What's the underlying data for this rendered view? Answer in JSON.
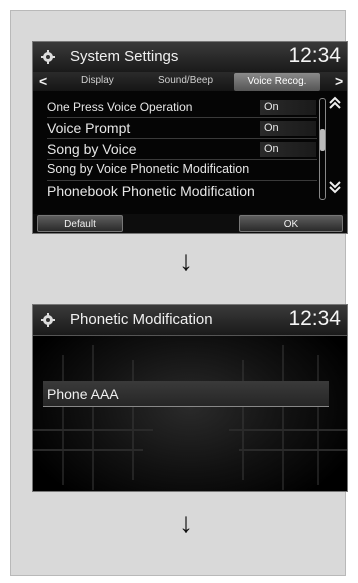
{
  "screen1": {
    "title": "System Settings",
    "clock": "12:34",
    "tabs": {
      "prev_arrow": "<",
      "tab1": "Display",
      "tab2": "Sound/Beep",
      "tab3_active": "Voice Recog.",
      "next_arrow": ">"
    },
    "rows": [
      {
        "label": "One Press Voice Operation",
        "value": "On"
      },
      {
        "label": "Voice Prompt",
        "value": "On"
      },
      {
        "label": "Song by Voice",
        "value": "On"
      },
      {
        "label": "Song by Voice Phonetic Modification",
        "value": ""
      },
      {
        "label": "Phonebook Phonetic Modification",
        "value": ""
      }
    ],
    "scroll_up": "⌃",
    "scroll_down": "⌄",
    "default_button": "Default",
    "ok_button": "OK"
  },
  "arrows": {
    "down1": "↓",
    "down2": "↓"
  },
  "screen2": {
    "title": "Phonetic Modification",
    "clock": "12:34",
    "entry": "Phone AAA"
  },
  "colors": {
    "screen_bg": "#050505",
    "panel_bg": "#d9d9d9",
    "text": "#e6e6e6"
  },
  "icons": {
    "settings": "gear-icon"
  }
}
